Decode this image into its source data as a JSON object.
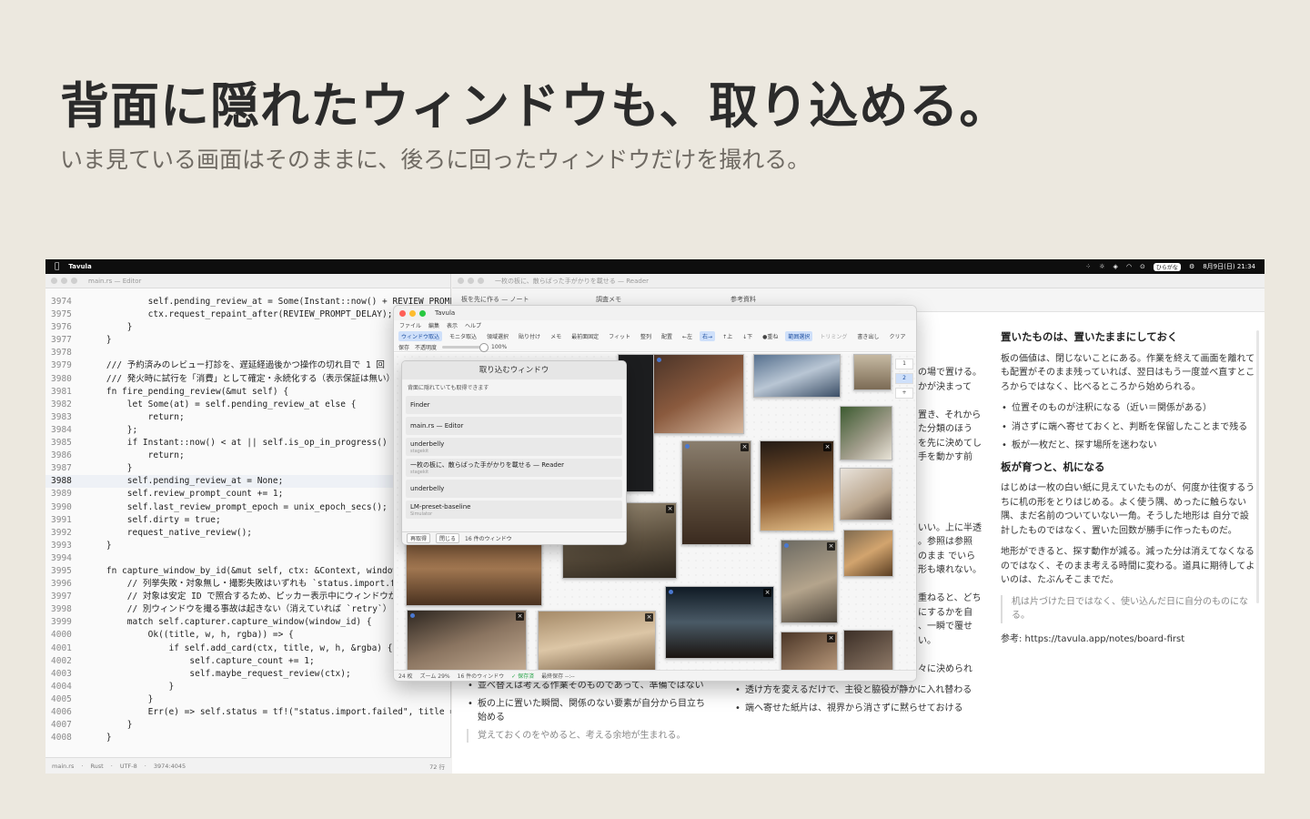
{
  "hero": {
    "title": "背面に隠れたウィンドウも、取り込める。",
    "subtitle": "いま見ている画面はそのままに、後ろに回ったウィンドウだけを撮れる。"
  },
  "menubar": {
    "app_name": "Tavula",
    "input_mode": "ひらがな",
    "datetime": "8月9日(日) 21:34"
  },
  "editor": {
    "title": "main.rs — Editor",
    "current_line": "3988",
    "lines": [
      {
        "n": "3974",
        "t": "            self.pending_review_at = Some(Instant::now() + REVIEW_PROMPT_DELAY);"
      },
      {
        "n": "3975",
        "t": "            ctx.request_repaint_after(REVIEW_PROMPT_DELAY);"
      },
      {
        "n": "3976",
        "t": "        }"
      },
      {
        "n": "3977",
        "t": "    }"
      },
      {
        "n": "3978",
        "t": ""
      },
      {
        "n": "3979",
        "t": "    /// 予約済みのレビュー打診を、遅延経過後かつ操作の切れ目で 1 回"
      },
      {
        "n": "3980",
        "t": "    /// 発火時に試行を「消費」として確定・永続化する（表示保証は無い）"
      },
      {
        "n": "3981",
        "t": "    fn fire_pending_review(&mut self) {"
      },
      {
        "n": "3982",
        "t": "        let Some(at) = self.pending_review_at else {"
      },
      {
        "n": "3983",
        "t": "            return;"
      },
      {
        "n": "3984",
        "t": "        };"
      },
      {
        "n": "3985",
        "t": "        if Instant::now() < at || self.is_op_in_progress() {"
      },
      {
        "n": "3986",
        "t": "            return;"
      },
      {
        "n": "3987",
        "t": "        }"
      },
      {
        "n": "3988",
        "t": "        self.pending_review_at = None;"
      },
      {
        "n": "3989",
        "t": "        self.review_prompt_count += 1;"
      },
      {
        "n": "3990",
        "t": "        self.last_review_prompt_epoch = unix_epoch_secs();"
      },
      {
        "n": "3991",
        "t": "        self.dirty = true;"
      },
      {
        "n": "3992",
        "t": "        request_native_review();"
      },
      {
        "n": "3993",
        "t": "    }"
      },
      {
        "n": "3994",
        "t": ""
      },
      {
        "n": "3995",
        "t": "    fn capture_window_by_id(&mut self, ctx: &Context, window_id: u32) {"
      },
      {
        "n": "3996",
        "t": "        // 列挙失敗・対象無し・撮影失敗はいずれも `status.import.failed`"
      },
      {
        "n": "3997",
        "t": "        // 対象は安定 ID で照合するため、ピッカー表示中にウィンドウが"
      },
      {
        "n": "3998",
        "t": "        // 別ウィンドウを撮る事故は起きない（消えていれば `retry`）"
      },
      {
        "n": "3999",
        "t": "        match self.capturer.capture_window(window_id) {"
      },
      {
        "n": "4000",
        "t": "            Ok((title, w, h, rgba)) => {"
      },
      {
        "n": "4001",
        "t": "                if self.add_card(ctx, title, w, h, &rgba) {"
      },
      {
        "n": "4002",
        "t": "                    self.capture_count += 1;"
      },
      {
        "n": "4003",
        "t": "                    self.maybe_request_review(ctx);"
      },
      {
        "n": "4004",
        "t": "                }"
      },
      {
        "n": "4005",
        "t": "            }"
      },
      {
        "n": "4006",
        "t": "            Err(e) => self.status = tf!(\"status.import.failed\", title = ...),"
      },
      {
        "n": "4007",
        "t": "        }"
      },
      {
        "n": "4008",
        "t": "    }"
      }
    ],
    "status": {
      "file": "main.rs",
      "lang": "Rust",
      "encoding": "UTF-8",
      "pos": "3974:4045",
      "right": "72 行"
    }
  },
  "reader": {
    "title": "一枚の板に、散らばった手がかりを載せる — Reader",
    "tabs": [
      "板を先に作る — ノート",
      "調査メモ",
      "参考資料"
    ],
    "col3": {
      "h1": "置いたものは、置いたままにしておく",
      "p1": "板の価値は、閉じないことにある。作業を終えて画面を離れても配置がそのまま残っていれば、翌日はもう一度並べ直すところからではなく、比べるところから始められる。",
      "list1": [
        "位置そのものが注釈になる（近い＝関係がある）",
        "消さずに端へ寄せておくと、判断を保留したことまで残る",
        "板が一枚だと、探す場所を迷わない"
      ],
      "h2": "板が育つと、机になる",
      "p2": "はじめは一枚の白い紙に見えていたものが、何度か往復するうちに机の形をとりはじめる。よく使う隅、めったに触らない隅、まだ名前のついていない一角。そうした地形は 自分で設計したものではなく、置いた回数が勝手に作ったものだ。",
      "p3": "地形ができると、探す動作が減る。減った分は消えてなくなるのではなく、そのまま考える時間に変わる。道具に期待してよいのは、たぶんそこまでだ。",
      "quote": "机は片づけた日ではなく、使い込んだ日に自分のものになる。",
      "ref": "参考: https://tavula.app/notes/board-first"
    },
    "col2_peek": [
      "の場で置ける。",
      "かが決まって",
      "",
      "置き、それから",
      "た分類のほう",
      "を先に決めてし",
      "手を動かす前",
      "",
      "",
      "",
      "",
      "いい。上に半透",
      "。参照は参照",
      "のまま でいら",
      "形も壊れない。",
      "",
      "重ねると、どち",
      "にするかを自",
      "、一瞬で覆せ",
      "い。",
      "",
      "々に決められ"
    ],
    "col1_bottom": {
      "items": [
        "並べ替えは考える作業そのものであって、準備ではない",
        "板の上に置いた瞬間、関係のない要素が自分から目立ち始める"
      ],
      "quote": "覚えておくのをやめると、考える余地が生まれる。"
    },
    "col2_bottom": {
      "items": [
        "透け方を変えるだけで、主役と脇役が静かに入れ替わる",
        "端へ寄せた紙片は、視界から消さずに黙らせておける"
      ]
    }
  },
  "tavula": {
    "title": "Tavula",
    "menu": [
      "ファイル",
      "編集",
      "表示",
      "ヘルプ"
    ],
    "toolbar": [
      {
        "label": "ウィンドウ取込",
        "state": "on"
      },
      {
        "label": "モニタ取込",
        "state": ""
      },
      {
        "label": "領域選択",
        "state": ""
      },
      {
        "label": "貼り付け",
        "state": ""
      },
      {
        "label": "メモ",
        "state": ""
      },
      {
        "label": "最前面固定",
        "state": ""
      },
      {
        "label": "フィット",
        "state": ""
      },
      {
        "label": "整列",
        "state": ""
      },
      {
        "label": "配置",
        "state": ""
      },
      {
        "label": "←左",
        "state": ""
      },
      {
        "label": "右→",
        "state": "on"
      },
      {
        "label": "↑上",
        "state": ""
      },
      {
        "label": "↓下",
        "state": ""
      },
      {
        "label": "●重ね",
        "state": ""
      },
      {
        "label": "範囲選択",
        "state": "on"
      },
      {
        "label": "トリミング",
        "state": "dim"
      },
      {
        "label": "書き出し",
        "state": ""
      },
      {
        "label": "クリア",
        "state": ""
      }
    ],
    "toolbar2": {
      "save": "保存",
      "opacity_label": "不透明度",
      "opacity_value": "100%"
    },
    "side_tabs": [
      "1",
      "2",
      "+"
    ],
    "active_side_tab": "2",
    "status": {
      "count": "24 枚",
      "zoom": "ズーム 29%",
      "windows": "16 件のウィンドウ",
      "saved": "✓ 保存済",
      "last_saved": "最終保存 --:--"
    }
  },
  "picker": {
    "title": "取り込むウィンドウ",
    "note": "背面に隠れていても取得できます",
    "items": [
      {
        "title": "Finder",
        "sub": ""
      },
      {
        "title": "main.rs — Editor",
        "sub": ""
      },
      {
        "title": "underbelly",
        "sub": "stagekit"
      },
      {
        "title": "一枚の板に、散らばった手がかりを載せる — Reader",
        "sub": "stagekit"
      },
      {
        "title": "underbelly",
        "sub": ""
      },
      {
        "title": "LM-preset-baseline",
        "sub": "Simulator"
      }
    ],
    "footer": {
      "refresh": "再取得",
      "close": "閉じる",
      "count": "16 件のウィンドウ"
    }
  },
  "colors": {
    "background": "#ece8df",
    "accent": "#1e4fa0",
    "selected": "#cfe0fa",
    "saved": "#2aa44a"
  }
}
